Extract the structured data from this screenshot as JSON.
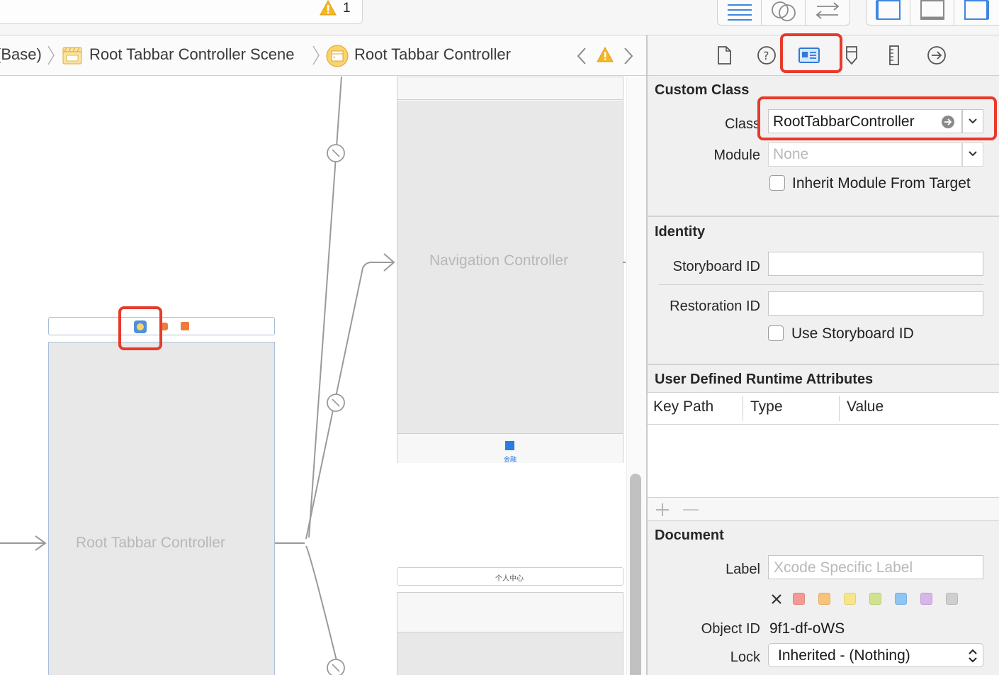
{
  "toolbar": {
    "warning_count": "1"
  },
  "breadcrumb": {
    "item1": "(Base)",
    "item2": "Root Tabbar Controller Scene",
    "item3": "Root Tabbar Controller"
  },
  "canvas": {
    "nav_controller_title": "Navigation Controller",
    "root_tabbar_title": "Root Tabbar Controller",
    "tab_item_label": "金融",
    "bottom_scene_title": "个人中心"
  },
  "inspector": {
    "tabs": [
      "file-inspector-icon",
      "quick-help-icon",
      "identity-inspector-icon",
      "attributes-inspector-icon",
      "size-inspector-icon",
      "connections-inspector-icon"
    ],
    "custom_class": {
      "title": "Custom Class",
      "class_label": "Class",
      "class_value": "RootTabbarController",
      "module_label": "Module",
      "module_placeholder": "None",
      "inherit_label": "Inherit Module From Target"
    },
    "identity": {
      "title": "Identity",
      "storyboard_id_label": "Storyboard ID",
      "storyboard_id_value": "",
      "restoration_id_label": "Restoration ID",
      "restoration_id_value": "",
      "use_storyboard_id_label": "Use Storyboard ID"
    },
    "runtime_attributes": {
      "title": "User Defined Runtime Attributes",
      "columns": [
        "Key Path",
        "Type",
        "Value"
      ]
    },
    "document": {
      "title": "Document",
      "label_label": "Label",
      "label_placeholder": "Xcode Specific Label",
      "object_id_label": "Object ID",
      "object_id_value": "9f1-df-oWS",
      "lock_label": "Lock",
      "lock_value": "Inherited - (Nothing)",
      "swatch_colors": [
        "#f29a96",
        "#f7c27a",
        "#f6e58a",
        "#cfe38e",
        "#8fc5f4",
        "#d7b6ea",
        "#cfcfcf"
      ]
    }
  },
  "colors": {
    "highlight": "#e8392b",
    "accent": "#2f7ad8"
  }
}
